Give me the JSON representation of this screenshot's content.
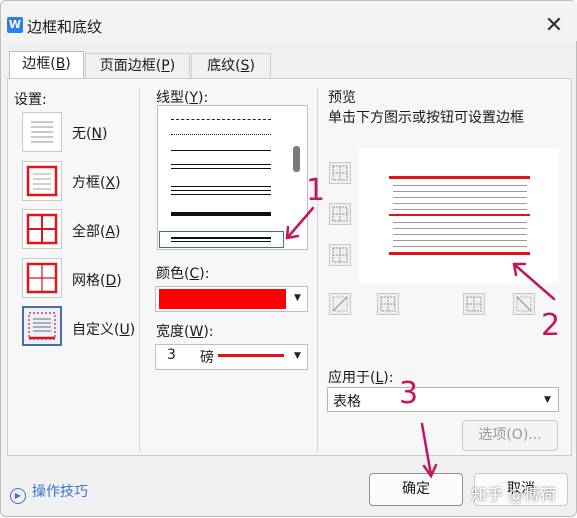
{
  "window": {
    "app_icon": "W",
    "title": "边框和底纹",
    "close": "✕"
  },
  "tabs": [
    {
      "label": "边框(",
      "key": "B",
      "close": ")"
    },
    {
      "label": "页面边框(",
      "key": "P",
      "close": ")"
    },
    {
      "label": "底纹(",
      "key": "S",
      "close": ")"
    }
  ],
  "settings": {
    "heading": "设置:",
    "items": [
      {
        "label": "无(",
        "key": "N",
        "close": ")"
      },
      {
        "label": "方框(",
        "key": "X",
        "close": ")"
      },
      {
        "label": "全部(",
        "key": "A",
        "close": ")"
      },
      {
        "label": "网格(",
        "key": "D",
        "close": ")"
      },
      {
        "label": "自定义(",
        "key": "U",
        "close": ")"
      }
    ]
  },
  "line_style": {
    "heading": "线型(",
    "key": "Y",
    "close": "):"
  },
  "color": {
    "heading": "颜色(",
    "key": "C",
    "close": "):",
    "value_hex": "#ff0000"
  },
  "width": {
    "heading": "宽度(",
    "key": "W",
    "close": "):",
    "value": "3",
    "unit": "磅"
  },
  "preview": {
    "heading": "预览",
    "hint": "单击下方图示或按钮可设置边框"
  },
  "apply_to": {
    "heading": "应用于(",
    "key": "L",
    "close": "):",
    "value": "表格"
  },
  "buttons": {
    "options": "选项(O)...",
    "ok": "确定",
    "cancel": "取消"
  },
  "tips": {
    "label": "操作技巧"
  },
  "annotations": [
    "1",
    "2",
    "3"
  ],
  "watermark": "知乎 @博荷",
  "colors": {
    "accent_red": "#e0141b",
    "annotation": "#c2185b",
    "link": "#3b74c9"
  }
}
